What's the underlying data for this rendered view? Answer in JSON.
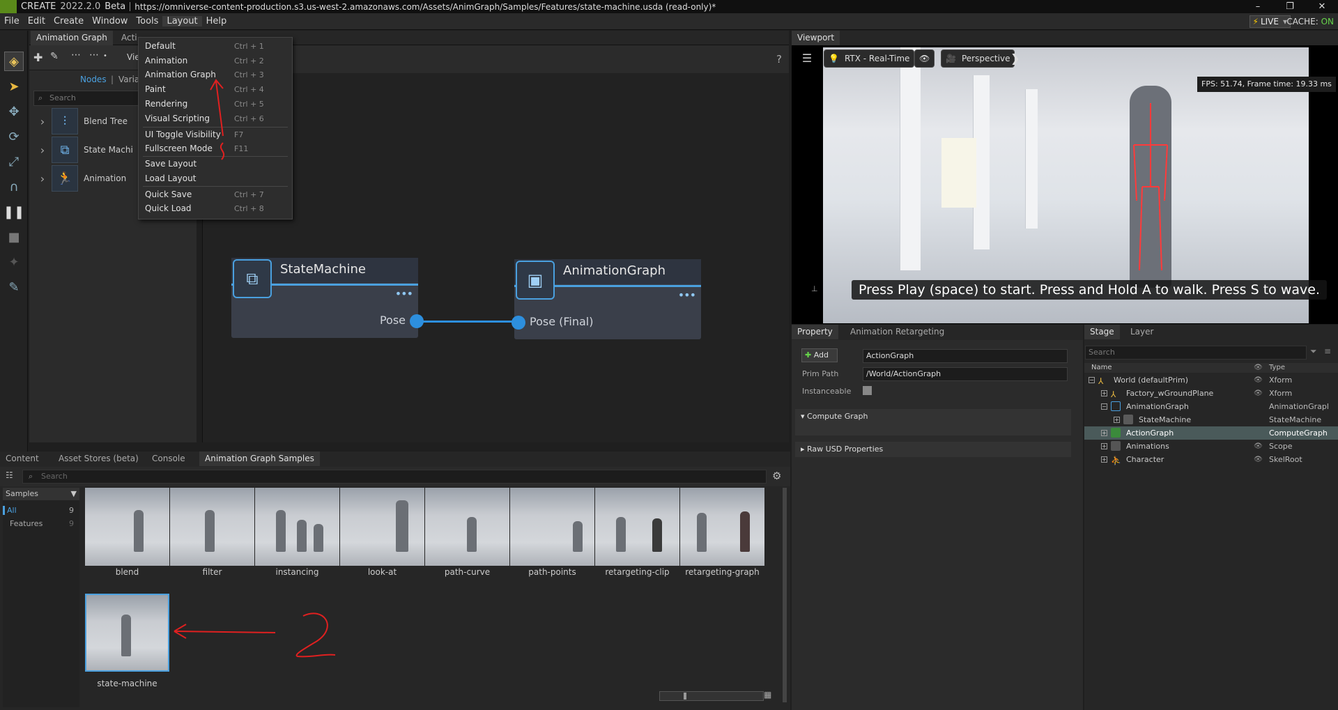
{
  "app": {
    "name": "CREATE",
    "version": "2022.2.0",
    "channel": "Beta",
    "url": "https://omniverse-content-production.s3.us-west-2.amazonaws.com/Assets/AnimGraph/Samples/Features/state-machine.usda (read-only)*",
    "live": "LIVE",
    "cache_label": "CACHE:",
    "cache_state": "ON"
  },
  "window_buttons": [
    "–",
    "❐",
    "✕"
  ],
  "menu": [
    "File",
    "Edit",
    "Create",
    "Window",
    "Tools",
    "Layout",
    "Help"
  ],
  "layout_menu": [
    {
      "label": "Default",
      "shortcut": "Ctrl + 1"
    },
    {
      "label": "Animation",
      "shortcut": "Ctrl + 2"
    },
    {
      "label": "Animation Graph",
      "shortcut": "Ctrl + 3"
    },
    {
      "label": "Paint",
      "shortcut": "Ctrl + 4"
    },
    {
      "label": "Rendering",
      "shortcut": "Ctrl + 5"
    },
    {
      "label": "Visual Scripting",
      "shortcut": "Ctrl + 6"
    },
    {
      "label": "UI Toggle Visibility",
      "shortcut": "F7"
    },
    {
      "label": "Fullscreen Mode",
      "shortcut": "F11"
    },
    {
      "label": "Save Layout",
      "shortcut": ""
    },
    {
      "label": "Load Layout",
      "shortcut": ""
    },
    {
      "label": "Quick Save",
      "shortcut": "Ctrl + 7"
    },
    {
      "label": "Quick Load",
      "shortcut": "Ctrl + 8"
    }
  ],
  "anim_graph": {
    "tab": "Animation Graph",
    "tab2": "Acti",
    "view_partial": "Vie",
    "nodes_tab": "Nodes",
    "vars_tab": "Varia",
    "search_placeholder": "Search",
    "node_list": [
      "Blend Tree",
      "State Machi",
      "Animation"
    ],
    "help": "?"
  },
  "graph_nodes": {
    "state_machine": {
      "title": "StateMachine",
      "port": "Pose"
    },
    "animation_graph": {
      "title": "AnimationGraph",
      "port": "Pose (Final)"
    }
  },
  "viewport": {
    "tab": "Viewport",
    "renderer": "RTX - Real-Time",
    "camera": "Perspective",
    "fps": "FPS: 51.74, Frame time: 19.33 ms",
    "caption": "Press Play (space) to start. Press and Hold A to walk. Press S to wave."
  },
  "property": {
    "tabs": [
      "Property",
      "Animation Retargeting"
    ],
    "add_label": "Add",
    "name_value": "ActionGraph",
    "prim_path_label": "Prim Path",
    "prim_path_value": "/World/ActionGraph",
    "instanceable_label": "Instanceable",
    "sections": [
      "Compute Graph",
      "Raw USD Properties"
    ]
  },
  "stage": {
    "tabs": [
      "Stage",
      "Layer"
    ],
    "search_placeholder": "Search",
    "columns": {
      "name": "Name",
      "type": "Type"
    },
    "rows": [
      {
        "name": "World (defaultPrim)",
        "type": "Xform",
        "indent": 0
      },
      {
        "name": "Factory_wGroundPlane",
        "type": "Xform",
        "indent": 1
      },
      {
        "name": "AnimationGraph",
        "type": "AnimationGrapl",
        "indent": 1
      },
      {
        "name": "StateMachine",
        "type": "StateMachine",
        "indent": 2
      },
      {
        "name": "ActionGraph",
        "type": "ComputeGraph",
        "indent": 1
      },
      {
        "name": "Animations",
        "type": "Scope",
        "indent": 1
      },
      {
        "name": "Character",
        "type": "SkelRoot",
        "indent": 1
      }
    ]
  },
  "bottom": {
    "tabs": [
      "Content",
      "Asset Stores (beta)",
      "Console",
      "Animation Graph Samples"
    ],
    "search_placeholder": "Search",
    "samples_label": "Samples",
    "categories": [
      {
        "name": "All",
        "count": "9"
      },
      {
        "name": "Features",
        "count": "9"
      }
    ],
    "samples": [
      "blend",
      "filter",
      "instancing",
      "look-at",
      "path-curve",
      "path-points",
      "retargeting-clip",
      "retargeting-graph",
      "state-machine"
    ]
  },
  "annotations": {
    "one": "1",
    "two": "2"
  },
  "colors": {
    "accent": "#2d8fde",
    "annotation": "#e02020",
    "live": "#66d34a"
  }
}
